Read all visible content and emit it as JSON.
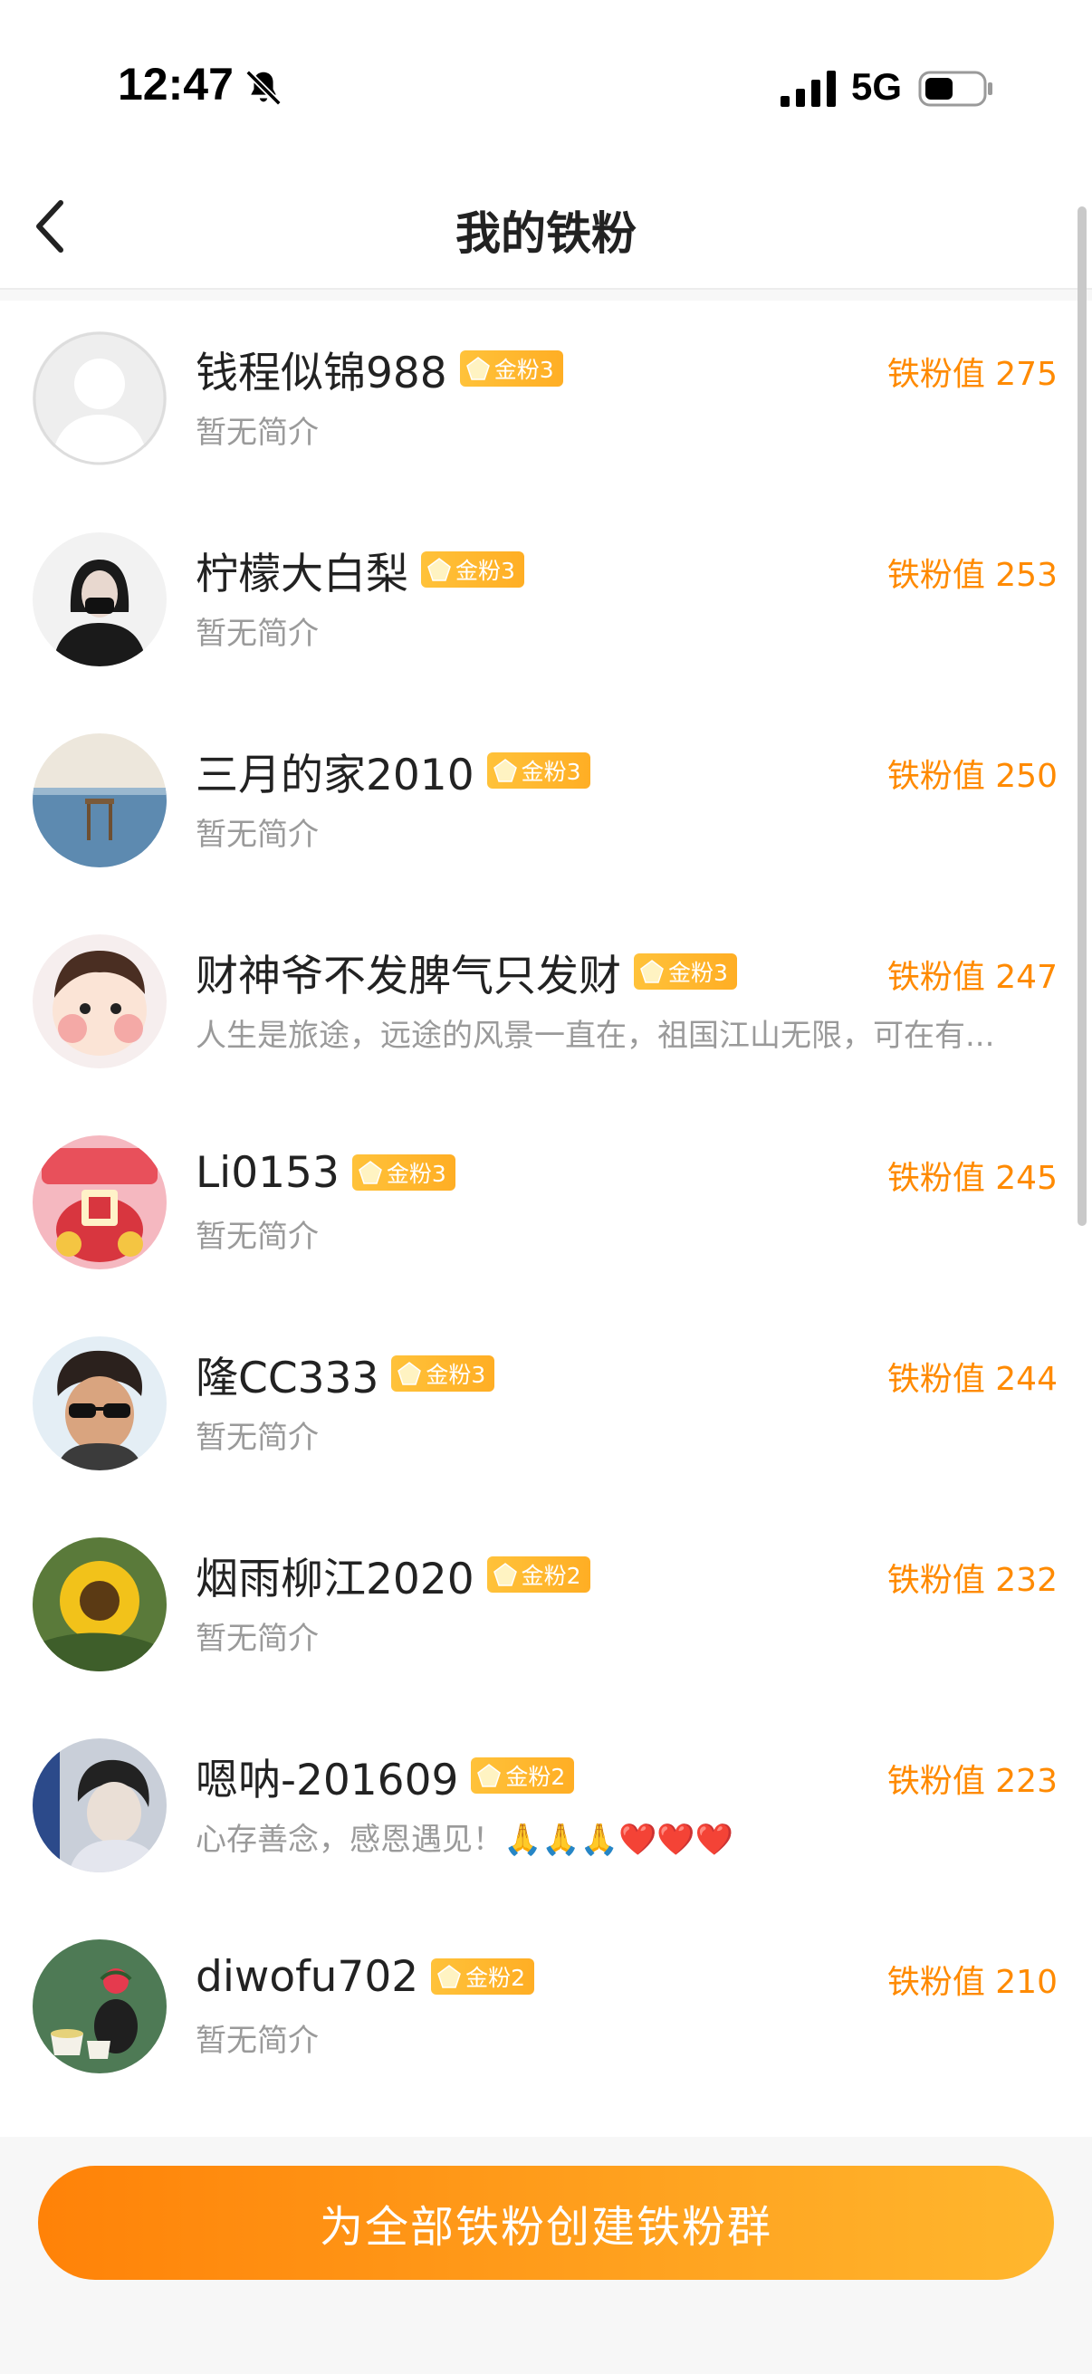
{
  "status_bar": {
    "time": "12:47",
    "network": "5G",
    "icons": [
      "bell-muted-icon",
      "signal-icon",
      "battery-icon"
    ]
  },
  "header": {
    "title": "我的铁粉",
    "back_icon": "chevron-left-icon"
  },
  "fans": [
    {
      "name": "钱程似锦988",
      "badge": "金粉3",
      "bio": "暂无简介",
      "score_label": "铁粉值",
      "score": "275"
    },
    {
      "name": "柠檬大白梨",
      "badge": "金粉3",
      "bio": "暂无简介",
      "score_label": "铁粉值",
      "score": "253"
    },
    {
      "name": "三月的家2010",
      "badge": "金粉3",
      "bio": "暂无简介",
      "score_label": "铁粉值",
      "score": "250"
    },
    {
      "name": "财神爷不发脾气只发财",
      "badge": "金粉3",
      "bio": "人生是旅途，远途的风景一直在，祖国江山无限，可在有...",
      "score_label": "铁粉值",
      "score": "247"
    },
    {
      "name": "Li0153",
      "badge": "金粉3",
      "bio": "暂无简介",
      "score_label": "铁粉值",
      "score": "245"
    },
    {
      "name": "隆CC333",
      "badge": "金粉3",
      "bio": "暂无简介",
      "score_label": "铁粉值",
      "score": "244"
    },
    {
      "name": "烟雨柳江2020",
      "badge": "金粉2",
      "bio": "暂无简介",
      "score_label": "铁粉值",
      "score": "232"
    },
    {
      "name": "嗯呐-201609",
      "badge": "金粉2",
      "bio": "心存善念，感恩遇见！🙏🙏🙏❤️❤️❤️",
      "score_label": "铁粉值",
      "score": "223"
    },
    {
      "name": "diwofu702",
      "badge": "金粉2",
      "bio": "暂无简介",
      "score_label": "铁粉值",
      "score": "210"
    }
  ],
  "bottom": {
    "button_label": "为全部铁粉创建铁粉群"
  },
  "colors": {
    "accent": "#ff8a00",
    "badge": "#ffb72e",
    "button_start": "#ff8208",
    "button_end": "#ffb72e"
  }
}
